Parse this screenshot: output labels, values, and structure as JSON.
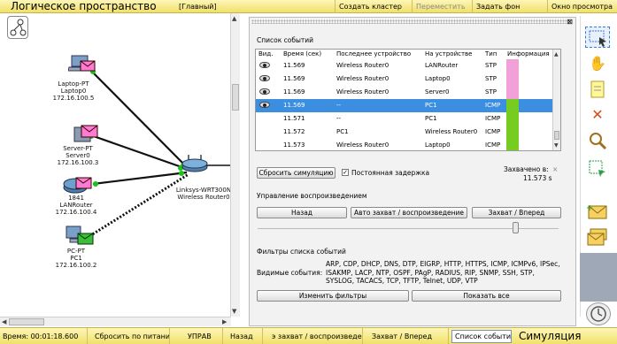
{
  "topbar": {
    "title": "Логическое пространство",
    "root_label": "[Главный]",
    "create_cluster": "Создать кластер",
    "move": "Переместить",
    "set_background": "Задать фон",
    "viewport": "Окно просмотра"
  },
  "devices": {
    "laptop": {
      "line1": "Laptop-PT",
      "line2": "Laptop0",
      "ip": "172.16.100.5"
    },
    "server": {
      "line1": "Server-PT",
      "line2": "Server0",
      "ip": "172.16.100.3"
    },
    "router": {
      "line1": "1841",
      "line2": "LANRouter",
      "ip": "172.16.100.4"
    },
    "pc": {
      "line1": "PC-PT",
      "line2": "PC1",
      "ip": "172.16.100.2"
    },
    "wireless": {
      "line1": "Linksys-WRT300N",
      "line2": "Wireless Router0"
    }
  },
  "sim_panel": {
    "event_list_title": "Список событий",
    "columns": [
      "Вид.",
      "Время (сек)",
      "Последнее устройство",
      "На устройстве",
      "Тип",
      "Информация"
    ],
    "events": [
      {
        "time": "11.569",
        "last": "Wireless Router0",
        "at": "LANRouter",
        "type": "STP",
        "color": "#f2a0d8",
        "eye": true,
        "selected": false
      },
      {
        "time": "11.569",
        "last": "Wireless Router0",
        "at": "Laptop0",
        "type": "STP",
        "color": "#f2a0d8",
        "eye": true,
        "selected": false
      },
      {
        "time": "11.569",
        "last": "Wireless Router0",
        "at": "Server0",
        "type": "STP",
        "color": "#f2a0d8",
        "eye": true,
        "selected": false
      },
      {
        "time": "11.569",
        "last": "--",
        "at": "PC1",
        "type": "ICMP",
        "color": "#77cc22",
        "eye": true,
        "selected": true
      },
      {
        "time": "11.571",
        "last": "--",
        "at": "PC1",
        "type": "ICMP",
        "color": "#77cc22",
        "eye": false,
        "selected": false
      },
      {
        "time": "11.572",
        "last": "PC1",
        "at": "Wireless Router0",
        "type": "ICMP",
        "color": "#77cc22",
        "eye": false,
        "selected": false
      },
      {
        "time": "11.573",
        "last": "Wireless Router0",
        "at": "Laptop0",
        "type": "ICMP",
        "color": "#77cc22",
        "eye": false,
        "selected": false
      }
    ],
    "reset_sim": "Сбросить симуляцию",
    "constant_delay": "Постоянная задержка",
    "constant_delay_checked": true,
    "captured_label": "Захвачено в:",
    "captured_value": "11.573 s",
    "playback_title": "Управление воспроизведением",
    "back": "Назад",
    "auto_capture": "Авто захват / воспроизведение",
    "capture_forward": "Захват / Вперед",
    "filters_title": "Фильтры списка событий",
    "visible_events_label": "Видимые события:",
    "visible_events": "ARP, CDP, DHCP, DNS, DTP, EIGRP, HTTP, HTTPS, ICMP, ICMPv6, IPSec, ISAKMP, LACP, NTP, OSPF, PAgP, RADIUS, RIP, SNMP, SSH, STP, SYSLOG, TACACS, TCP, TFTP, Telnet, UDP, VTP",
    "edit_filters": "Изменить фильтры",
    "show_all": "Показать все"
  },
  "bottombar": {
    "time_label": "Время: 00:01:18.600",
    "power_cycle": "Сбросить по питанию",
    "pdu": "УПРАВ",
    "back": "Назад",
    "auto_capture": "э захват / воспроизведе",
    "capture_forward": "Захват / Вперед",
    "event_list": "Список событий",
    "mode": "Симуляция"
  },
  "right_tools": [
    "select-icon",
    "hand-icon",
    "note-icon",
    "delete-icon",
    "inspect-icon",
    "resize-icon",
    "simple-pdu-icon",
    "complex-pdu-icon"
  ]
}
